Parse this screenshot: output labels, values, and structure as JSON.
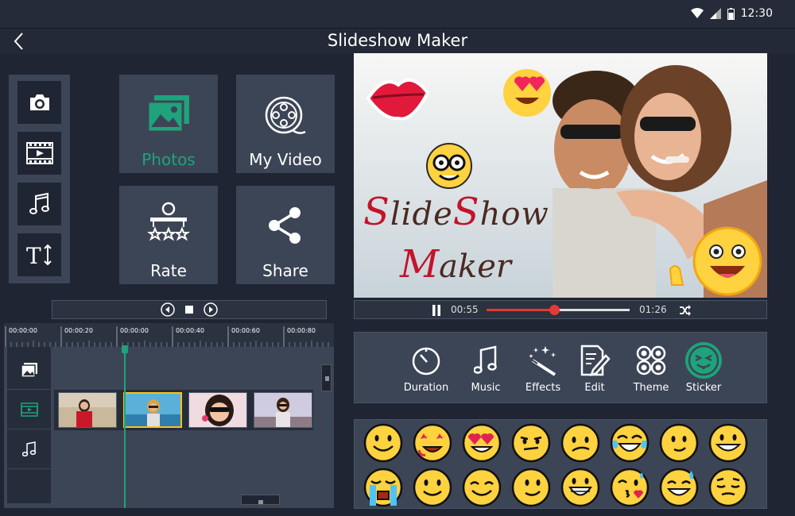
{
  "status": {
    "time": "12:30"
  },
  "header": {
    "title": "Slideshow Maker"
  },
  "main_tiles": [
    {
      "label": "Photos",
      "icon": "gallery-icon",
      "color": "#1ea37b"
    },
    {
      "label": "My Video",
      "icon": "film-reel-icon",
      "color": "#ffffff"
    },
    {
      "label": "Rate",
      "icon": "rate-stars-icon",
      "color": "#ffffff"
    },
    {
      "label": "Share",
      "icon": "share-icon",
      "color": "#ffffff"
    }
  ],
  "media_types": [
    "camera-icon",
    "video-film-icon",
    "music-note-icon",
    "text-size-icon"
  ],
  "timeline": {
    "ticks": [
      "00:00:00",
      "00:00:20",
      "00:00:00",
      "00:00:40",
      "00:00:60",
      "00:00:80"
    ],
    "track_icons": [
      "image-track-icon",
      "video-track-icon",
      "music-track-icon"
    ]
  },
  "preview": {
    "title_line1_caps": [
      "S",
      "lide",
      "S",
      "how"
    ],
    "title_line2_caps": [
      "M",
      "aker"
    ]
  },
  "player": {
    "current_time": "00:55",
    "total_time": "01:26",
    "progress": 0.47
  },
  "tools": [
    {
      "label": "Duration",
      "icon": "timer-icon"
    },
    {
      "label": "Music",
      "icon": "music-note-icon"
    },
    {
      "label": "Effects",
      "icon": "magic-wand-icon"
    },
    {
      "label": "Edit",
      "icon": "edit-pencil-icon"
    },
    {
      "label": "Theme",
      "icon": "theme-grid-icon"
    },
    {
      "label": "Sticker",
      "icon": "sticker-face-icon",
      "active": true
    }
  ],
  "accent_color": "#1ea37b",
  "stickers_count": 16
}
